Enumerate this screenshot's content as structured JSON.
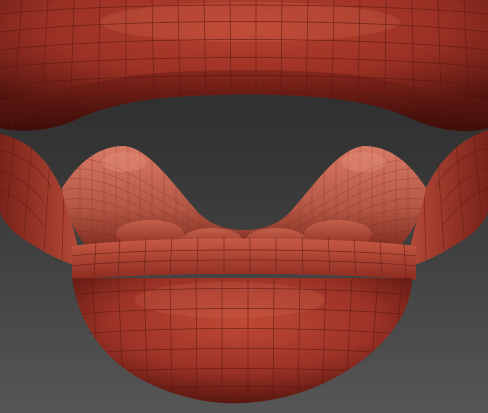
{
  "viewport": {
    "kind": "3d-sculpt-viewport",
    "display_mode": "polyframe-wireframe-overlay",
    "background_colors": {
      "top": "#2a2a2a",
      "bottom": "#565656"
    },
    "mesh": {
      "subject": "open-mouth-lips",
      "material_color": "#a8362b",
      "highlight_color": "#d9664f",
      "shadow_color": "#3e0d09",
      "wire_color": "#5a1712",
      "parts": [
        "upper-lip",
        "lower-lip",
        "tongue",
        "lower-teeth",
        "mouth-corner-left",
        "mouth-corner-right"
      ]
    }
  }
}
